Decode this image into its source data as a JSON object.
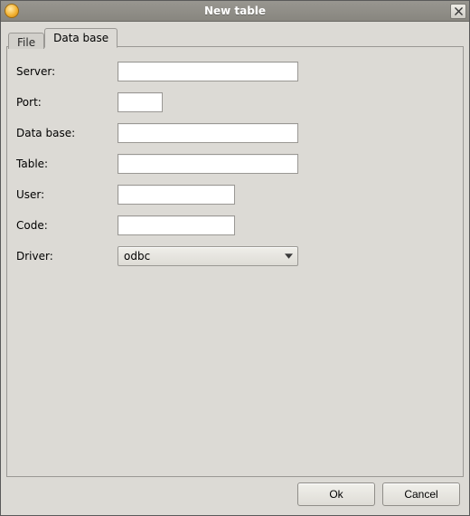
{
  "window": {
    "title": "New table"
  },
  "tabs": {
    "file": "File",
    "database": "Data base"
  },
  "form": {
    "server": {
      "label": "Server:",
      "value": ""
    },
    "port": {
      "label": "Port:",
      "value": ""
    },
    "database": {
      "label": "Data base:",
      "value": ""
    },
    "table": {
      "label": "Table:",
      "value": ""
    },
    "user": {
      "label": "User:",
      "value": ""
    },
    "code": {
      "label": "Code:",
      "value": ""
    },
    "driver": {
      "label": "Driver:",
      "value": "odbc"
    }
  },
  "buttons": {
    "ok": "Ok",
    "cancel": "Cancel"
  }
}
